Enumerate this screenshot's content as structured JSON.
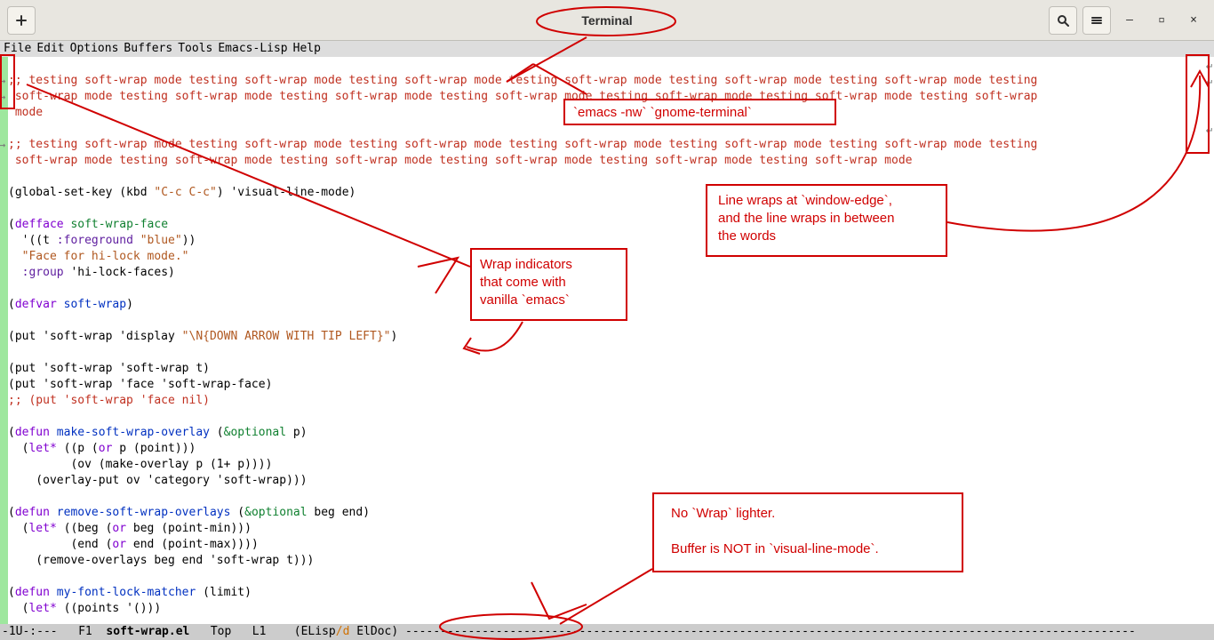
{
  "titlebar": {
    "title": "Terminal"
  },
  "window_controls": {
    "minimize": "—",
    "maximize": "▫",
    "close": "×"
  },
  "menubar": [
    "File",
    "Edit",
    "Options",
    "Buffers",
    "Tools",
    "Emacs-Lisp",
    "Help"
  ],
  "code": {
    "c1a": ";; testing soft-wrap mode testing soft-wrap mode testing soft-wrap mode testing soft-wrap mode testing soft-wrap mode testing soft-wrap mode testing",
    "c1b": " soft-wrap mode testing soft-wrap mode testing soft-wrap mode testing soft-wrap mode testing soft-wrap mode testing soft-wrap mode testing soft-wrap",
    "c1c": " mode",
    "blank1": "",
    "c2a": ";; testing soft-wrap mode testing soft-wrap mode testing soft-wrap mode testing soft-wrap mode testing soft-wrap mode testing soft-wrap mode testing",
    "c2b": " soft-wrap mode testing soft-wrap mode testing soft-wrap mode testing soft-wrap mode testing soft-wrap mode testing soft-wrap mode",
    "blank2": "",
    "l_gsk_a": "(global-set-key (kbd ",
    "l_gsk_s": "\"C-c C-c\"",
    "l_gsk_b": ") 'visual-line-mode)",
    "blank3": "",
    "l_df_a": "(",
    "l_df_kw": "defface",
    "l_df_sp": " ",
    "l_df_nm": "soft-wrap-face",
    "l_dfb1a": "  '((t ",
    "l_dfb1k": ":foreground",
    "l_dfb1b": " ",
    "l_dfb1s": "\"blue\"",
    "l_dfb1c": "))",
    "l_dfb2": "  \"Face for hi-lock mode.\"",
    "l_dfb3a": "  ",
    "l_dfb3k": ":group",
    "l_dfb3b": " 'hi-lock-faces)",
    "blank4": "",
    "l_dv_a": "(",
    "l_dv_kw": "defvar",
    "l_dv_b": " ",
    "l_dv_nm": "soft-wrap",
    "l_dv_c": ")",
    "blank5": "",
    "l_p1a": "(put 'soft-wrap 'display ",
    "l_p1s": "\"\\N{DOWN ARROW WITH TIP LEFT}\"",
    "l_p1b": ")",
    "blank6": "",
    "l_p2": "(put 'soft-wrap 'soft-wrap t)",
    "l_p3": "(put 'soft-wrap 'face 'soft-wrap-face)",
    "l_p4": ";; (put 'soft-wrap 'face nil)",
    "blank7": "",
    "l_d1_a": "(",
    "l_d1_kw": "defun",
    "l_d1_sp": " ",
    "l_d1_nm": "make-soft-wrap-overlay",
    "l_d1_b": " (",
    "l_d1_opt": "&optional",
    "l_d1_c": " p)",
    "l_d1l1a": "  (",
    "l_d1l1kw": "let*",
    "l_d1l1b": " ((p (",
    "l_d1l1or": "or",
    "l_d1l1c": " p (point)))",
    "l_d1l2": "         (ov (make-overlay p (1+ p))))",
    "l_d1l3": "    (overlay-put ov 'category 'soft-wrap)))",
    "blank8": "",
    "l_d2_a": "(",
    "l_d2_kw": "defun",
    "l_d2_sp": " ",
    "l_d2_nm": "remove-soft-wrap-overlays",
    "l_d2_b": " (",
    "l_d2_opt": "&optional",
    "l_d2_c": " beg end)",
    "l_d2l1a": "  (",
    "l_d2l1kw": "let*",
    "l_d2l1b": " ((beg (",
    "l_d2l1or": "or",
    "l_d2l1c": " beg (point-min)))",
    "l_d2l2a": "         (end (",
    "l_d2l2or": "or",
    "l_d2l2b": " end (point-max))))",
    "l_d2l3": "    (remove-overlays beg end 'soft-wrap t)))",
    "blank9": "",
    "l_d3_a": "(",
    "l_d3_kw": "defun",
    "l_d3_sp": " ",
    "l_d3_nm": "my-font-lock-matcher",
    "l_d3_b": " (limit)",
    "l_d3l1a": "  (",
    "l_d3l1kw": "let*",
    "l_d3l1b": " ((points '()))"
  },
  "modeline": {
    "left": "-1U-:---",
    "f1": "F1",
    "file": "soft-wrap.el",
    "pos": "Top",
    "line": "L1",
    "mode_a": "(ELisp",
    "mode_sep": "/",
    "mode_d": "d",
    "mode_b": " ElDoc)",
    "dashes": " ---------------------------------------------------------------------------------------------------------"
  },
  "annotations": {
    "a1": "`emacs -nw` `gnome-terminal`",
    "a2l1": "Wrap indicators",
    "a2l2": "that come with",
    "a2l3": "vanilla `emacs`",
    "a3l1": "Line wraps at `window-edge`,",
    "a3l2": " and the line wraps in between",
    "a3l3": "the words",
    "a4l1": "No `Wrap` lighter.",
    "a4l2": "Buffer is NOT in `visual-line-mode`."
  }
}
